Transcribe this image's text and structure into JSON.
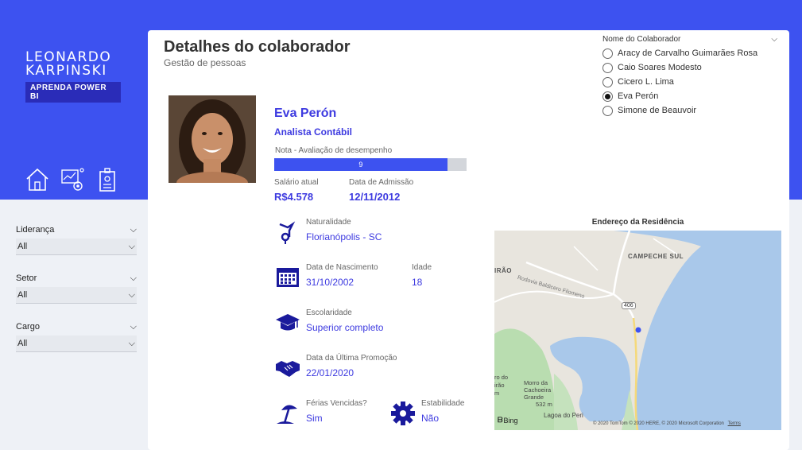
{
  "brand": {
    "line1": "LEONARDO",
    "line2": "KARPINSKI",
    "tagline": "APRENDA POWER BI"
  },
  "nav": [
    "home-icon",
    "analytics-icon",
    "badge-icon"
  ],
  "filters": [
    {
      "label": "Liderança",
      "value": "All"
    },
    {
      "label": "Setor",
      "value": "All"
    },
    {
      "label": "Cargo",
      "value": "All"
    }
  ],
  "header": {
    "title": "Detalhes do colaborador",
    "subtitle": "Gestão de pessoas"
  },
  "employee": {
    "name": "Eva Perón",
    "role": "Analista Contábil",
    "rating_label": "Nota - Avaliação de desempenho",
    "rating": "9",
    "rating_fraction": 0.9,
    "salary_label": "Salário atual",
    "salary": "R$4.578",
    "admission_label": "Data de Admissão",
    "admission": "12/11/2012",
    "birthplace_label": "Naturalidade",
    "birthplace": "Florianópolis - SC",
    "birth_label": "Data de Nascimento",
    "birth": "31/10/2002",
    "age_label": "Idade",
    "age": "18",
    "education_label": "Escolaridade",
    "education": "Superior completo",
    "promotion_label": "Data da Última Promoção",
    "promotion": "22/01/2020",
    "vacation_label": "Férias Vencidas?",
    "vacation": "Sim",
    "stability_label": "Estabilidade",
    "stability": "Não"
  },
  "slicer": {
    "title": "Nome do Colaborador",
    "options": [
      "Aracy de Carvalho Guimarães Rosa",
      "Caio Soares Modesto",
      "Cicero L. Lima",
      "Eva Perón",
      "Simone de Beauvoir"
    ],
    "selected": "Eva Perón"
  },
  "map": {
    "title": "Endereço da Residência",
    "labels": {
      "area1": "CAMPECHE SUL",
      "area2": "IRÃO",
      "road": "Rodovia Baldicero Filomeno",
      "highway": "406",
      "hill": "Morro da Cachoeira Grande",
      "hill_alt": "532 m",
      "lake": "Lagoa do Peri",
      "side1": "ro do",
      "side2": "irão",
      "side3": "m"
    },
    "attribution": "© 2020 TomTom © 2020 HERE, © 2020 Microsoft Corporation",
    "terms": "Terms",
    "provider": "Bing"
  },
  "colors": {
    "accent": "#3d52f0",
    "text_accent": "#3d3ae0",
    "icon": "#1a1a9c"
  }
}
